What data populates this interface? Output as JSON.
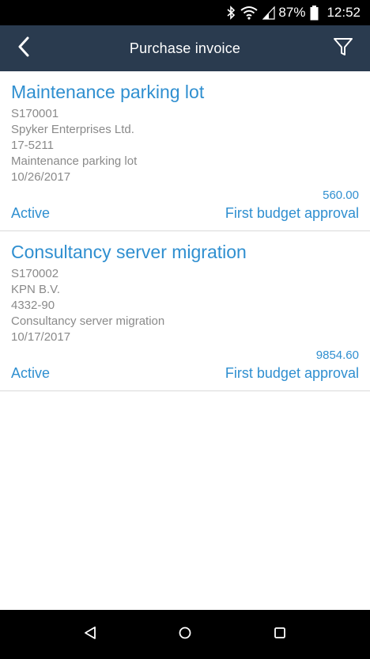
{
  "status_bar": {
    "battery_percent": "87%",
    "time": "12:52",
    "icons": [
      "bluetooth-icon",
      "wifi-icon",
      "cell-signal-icon",
      "battery-icon"
    ]
  },
  "app_bar": {
    "title": "Purchase invoice",
    "back_icon": "back-arrow-icon",
    "filter_icon": "filter-icon"
  },
  "invoices": [
    {
      "title": "Maintenance parking lot",
      "number": "S170001",
      "supplier": "Spyker Enterprises Ltd.",
      "reference": "17-5211",
      "description": "Maintenance parking lot",
      "date": "10/26/2017",
      "amount": "560.00",
      "status": "Active",
      "stage": "First budget approval"
    },
    {
      "title": "Consultancy server migration",
      "number": "S170002",
      "supplier": "KPN B.V.",
      "reference": "4332-90",
      "description": "Consultancy server migration",
      "date": "10/17/2017",
      "amount": "9854.60",
      "status": "Active",
      "stage": "First budget approval"
    }
  ],
  "nav_bar": {
    "icons": [
      "nav-back-icon",
      "nav-home-icon",
      "nav-recents-icon"
    ]
  },
  "colors": {
    "app_bar": "#2a3b4f",
    "accent": "#2f8fd0",
    "secondary_text": "#8a8a8a",
    "system_bar": "#000000"
  }
}
